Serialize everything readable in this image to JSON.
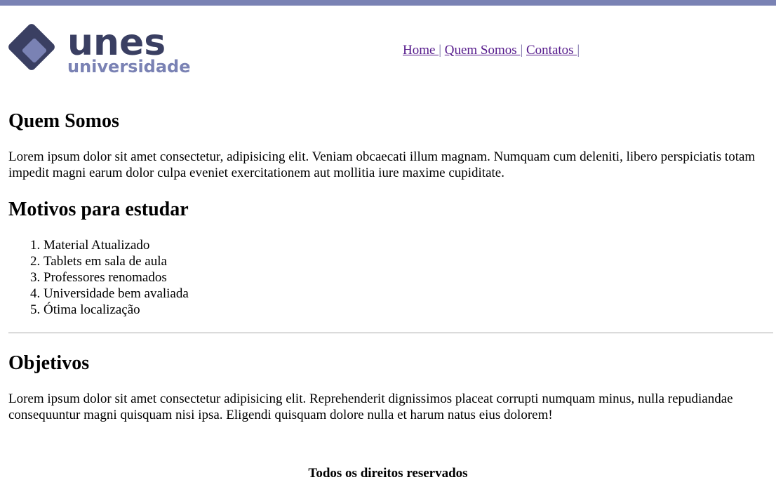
{
  "colors": {
    "top_bar": "#7a82b4",
    "logo_dark": "#3a3f62",
    "logo_light": "#7a82b4",
    "link_visited": "#551a8b"
  },
  "logo": {
    "word": "unes",
    "subword": "universidade"
  },
  "nav": {
    "items": [
      {
        "label": "Home "
      },
      {
        "label": "Quem Somos "
      },
      {
        "label": "Contatos "
      }
    ],
    "separator": "|"
  },
  "sections": {
    "about": {
      "title": "Quem Somos",
      "text": "Lorem ipsum dolor sit amet consectetur, adipisicing elit. Veniam obcaecati illum magnam. Numquam cum deleniti, libero perspiciatis totam impedit magni earum dolor culpa eveniet exercitationem aut mollitia iure maxime cupiditate."
    },
    "reasons": {
      "title": "Motivos para estudar",
      "items": [
        "Material Atualizado",
        "Tablets em sala de aula",
        "Professores renomados",
        "Universidade bem avaliada",
        "Ótima localização"
      ]
    },
    "goals": {
      "title": "Objetivos",
      "text": "Lorem ipsum dolor sit amet consectetur adipisicing elit. Reprehenderit dignissimos placeat corrupti numquam minus, nulla repudiandae consequuntur magni quisquam nisi ipsa. Eligendi quisquam dolore nulla et harum natus eius dolorem!"
    }
  },
  "footer": {
    "text": "Todos os direitos reservados"
  }
}
